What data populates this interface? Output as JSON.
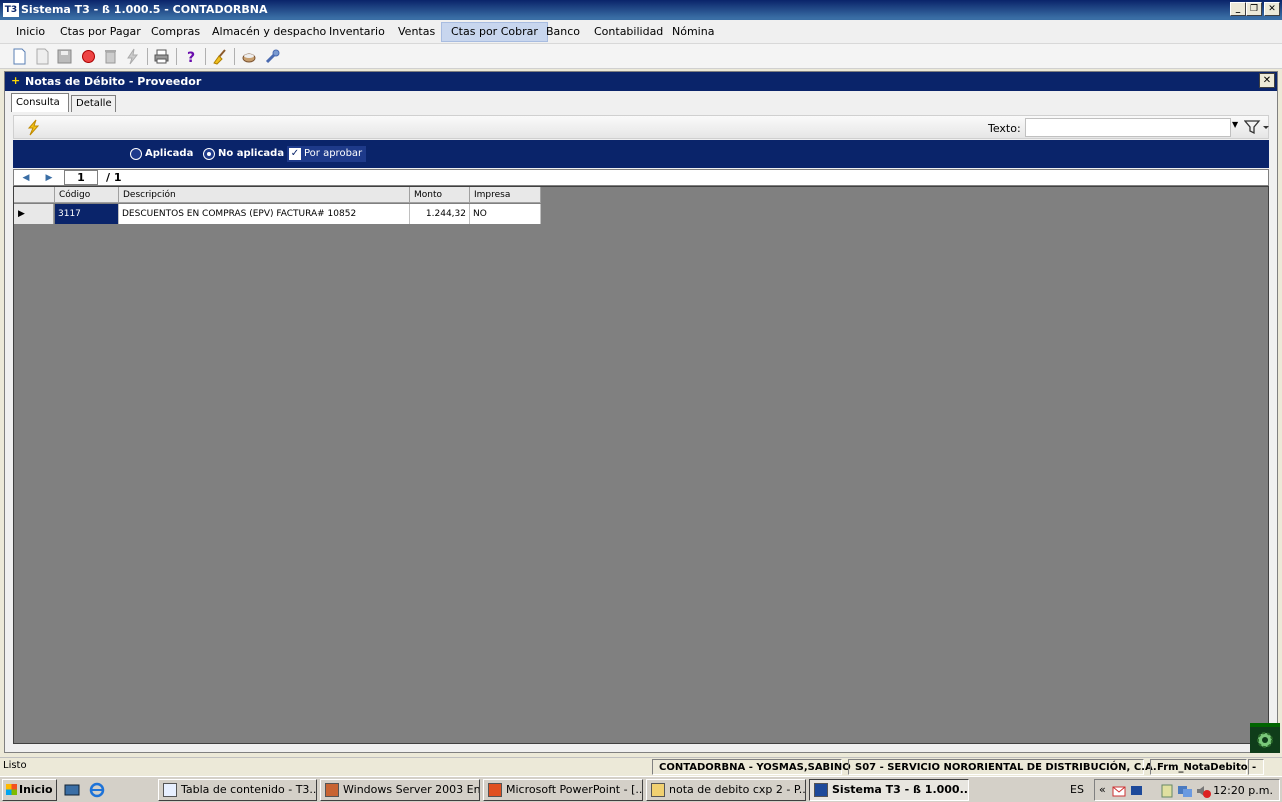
{
  "window": {
    "title": "Sistema T3 - ß 1.000.5 - CONTADORBNA",
    "app_icon_text": "T3",
    "btn_min": "_",
    "btn_restore": "❐",
    "btn_close": "✕"
  },
  "menu": [
    "Inicio",
    "Ctas por Pagar",
    "Compras",
    "Almacén y despacho",
    "Inventario",
    "Ventas",
    "Ctas por Cobrar",
    "Banco",
    "Contabilidad",
    "Nómina"
  ],
  "active_menu": "Ctas por Cobrar",
  "toolbar_icons": [
    "new-icon",
    "open-icon",
    "save-icon",
    "record-icon",
    "delete-icon",
    "lightning-icon",
    "print-icon",
    "help-icon",
    "broom-icon",
    "coffee-icon",
    "tools-icon"
  ],
  "form": {
    "title": "Notas de Débito - Proveedor",
    "tabs": [
      "Consulta",
      "Detalle"
    ],
    "selected_tab": "Consulta",
    "search": {
      "label": "Texto:",
      "value": ""
    },
    "options": {
      "aplicada": "Aplicada",
      "no_aplicada": "No aplicada",
      "por_aprobar": "Por aprobar"
    },
    "pager": {
      "current": "1",
      "total": "/ 1"
    },
    "grid": {
      "headers": [
        "Código",
        "Descripción",
        "Monto",
        "Impresa"
      ],
      "rows": [
        {
          "codigo": "3117",
          "descripcion": "DESCUENTOS EN COMPRAS (EPV) FACTURA# 10852",
          "monto": "1.244,32",
          "impresa": "NO"
        }
      ]
    }
  },
  "status": {
    "left": "Listo",
    "user": "CONTADORBNA - YOSMAS,SABINO",
    "company": "S07 - SERVICIO NORORIENTAL DE DISTRIBUCIÓN, C.A.",
    "form_name": "Frm_NotaDebito",
    "dash": "-"
  },
  "taskbar": {
    "start": "Inicio",
    "buttons": [
      "Tabla de contenido - T3....",
      "Windows Server 2003 En...",
      "Microsoft PowerPoint - [...",
      "nota de debito  cxp 2 - P...",
      "Sistema T3 - ß 1.000...."
    ],
    "language": "ES",
    "clock": "12:20 p.m."
  }
}
